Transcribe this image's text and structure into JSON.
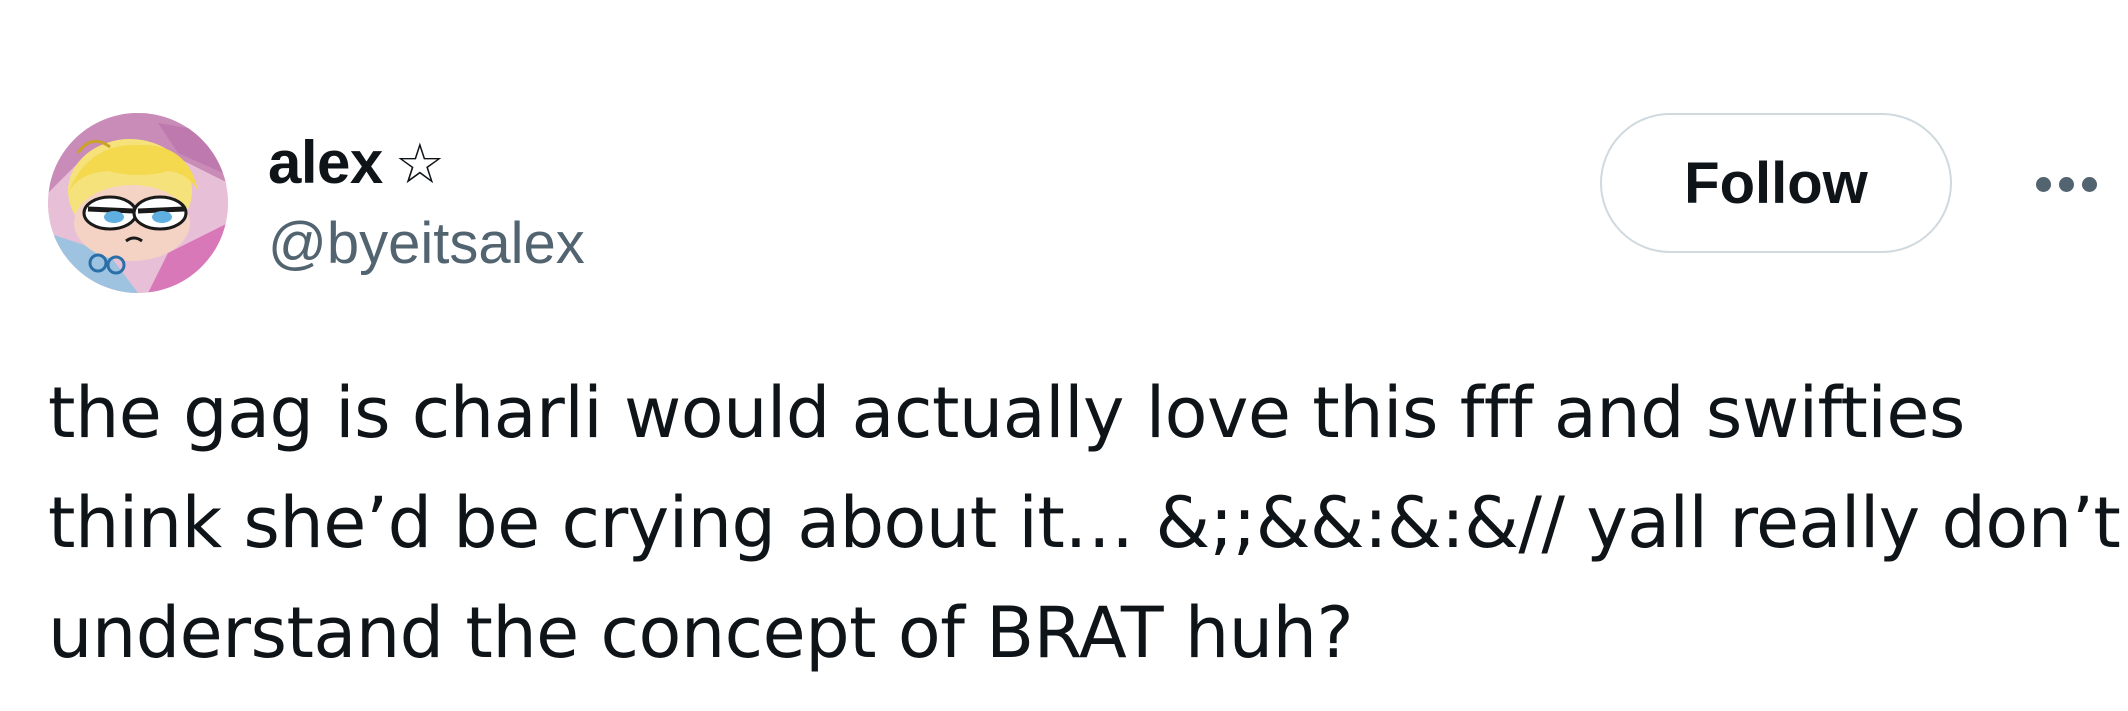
{
  "author": {
    "display_name": "alex",
    "badge": "☆",
    "handle": "@byeitsalex",
    "avatar_icon": "cartoon-avatar"
  },
  "actions": {
    "follow_label": "Follow",
    "more_icon": "more-horizontal-icon"
  },
  "tweet": {
    "lines": [
      "the gag is charli would actually love this fff and swifties",
      "think she’d be crying about it… &;;&&:&:&// yall really don’t",
      "understand the concept of BRAT huh?"
    ]
  },
  "colors": {
    "text_primary": "#0f1419",
    "text_secondary": "#536471",
    "follow_border": "#cfd9de",
    "background": "#ffffff"
  }
}
